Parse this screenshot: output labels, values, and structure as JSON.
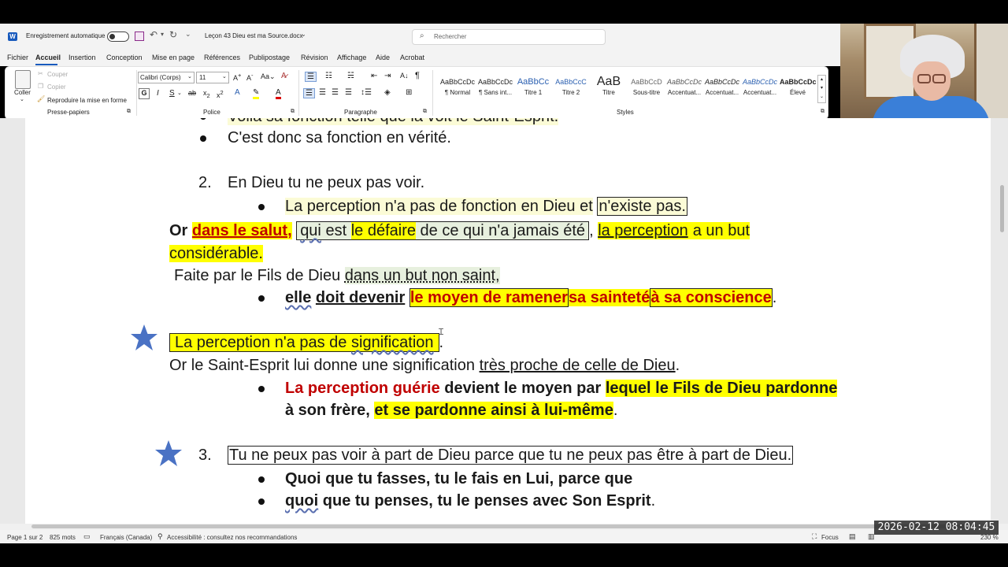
{
  "window": {
    "autosave_label": "Enregistrement automatique",
    "doc_title": "Leçon 43 Dieu est ma Source.docx",
    "search_placeholder": "Rechercher"
  },
  "menu_tabs": [
    "Fichier",
    "Accueil",
    "Insertion",
    "Conception",
    "Mise en page",
    "Références",
    "Publipostage",
    "Révision",
    "Affichage",
    "Aide",
    "Acrobat"
  ],
  "ribbon": {
    "paste_label": "Coller",
    "cut_label": "Couper",
    "copy_label": "Copier",
    "format_painter_label": "Reproduire la mise en forme",
    "clipboard_group": "Presse-papiers",
    "font_name": "Calibri (Corps)",
    "font_size": "11",
    "font_group": "Police",
    "paragraph_group": "Paragraphe",
    "styles_group": "Styles",
    "styles": [
      {
        "sample": "AaBbCcDc",
        "name": "¶ Normal"
      },
      {
        "sample": "AaBbCcDc",
        "name": "¶ Sans int..."
      },
      {
        "sample": "AaBbCc",
        "name": "Titre 1"
      },
      {
        "sample": "AaBbCcC",
        "name": "Titre 2"
      },
      {
        "sample": "AaB",
        "name": "Titre"
      },
      {
        "sample": "AaBbCcD",
        "name": "Sous-titre"
      },
      {
        "sample": "AaBbCcDc",
        "name": "Accentuat..."
      },
      {
        "sample": "AaBbCcDc",
        "name": "Accentuat..."
      },
      {
        "sample": "AaBbCcDc",
        "name": "Accentuat..."
      },
      {
        "sample": "AaBbCcDc",
        "name": "Élevé"
      }
    ]
  },
  "document": {
    "line_top_partial": "Voilà sa fonction telle que la voit le Saint-Esprit.",
    "line_1": "C'est donc sa fonction en vérité.",
    "item2_number": "2.",
    "item2_text": "En Dieu tu ne peux pas voir.",
    "line_3a": "La perception n'a pas de fonction en Dieu et",
    "line_3b": "n'existe pas.",
    "line_4_or": "Or",
    "line_4_dans": "dans le salut",
    "line_4_comma": ",",
    "line_4_qui": "qui",
    "line_4_est": "est",
    "line_4_defaire": "le défaire",
    "line_4_rest": "de ce qui n'a jamais été",
    "line_4_comma2": ",",
    "line_4_perc": "la perception",
    "line_4_but": "a un but",
    "line_5": "considérable.",
    "line_6a": "Faite par le Fils de Dieu",
    "line_6b": "dans un but non saint,",
    "line_7_elle": "elle",
    "line_7_doit": "doit devenir",
    "line_7_moyen": "le moyen de ramener",
    "line_7_saintete": "sa sainteté",
    "line_7_conscience": "à sa conscience",
    "line_7_dot": ".",
    "line_8a": "La perception n'a pas de",
    "line_8b": "signification",
    "line_8_dot": ".",
    "line_9a": "Or le Saint-Esprit lui donne une signification",
    "line_9b": "très proche de celle de Dieu",
    "line_9_dot": ".",
    "line_10a": "La perception guérie",
    "line_10b": "devient le moyen par",
    "line_10c": "lequel le Fils de Dieu pardonne",
    "line_11a": "à son frère,",
    "line_11b": "et se pardonne ainsi à lui-même",
    "line_11_dot": ".",
    "item3_number": "3.",
    "item3_text": "Tu ne peux pas voir à part de Dieu parce que tu ne peux pas être à part de Dieu.",
    "line_13": "Quoi que tu fasses, tu le fais en Lui, parce que",
    "line_14a": "quoi",
    "line_14b": "que tu penses, tu le penses avec Son Esprit",
    "line_14_dot": "."
  },
  "status": {
    "page": "Page 1 sur 2",
    "words": "825 mots",
    "language": "Français (Canada)",
    "accessibility": "Accessibilité : consultez nos recommandations",
    "focus": "Focus",
    "zoom": "230 %"
  },
  "timestamp": "2026-02-12 08:04:45",
  "colors": {
    "highlight_yellow": "#ffff00",
    "red_text": "#c00000",
    "star_blue": "#4a72c4",
    "word_blue": "#185abd"
  }
}
